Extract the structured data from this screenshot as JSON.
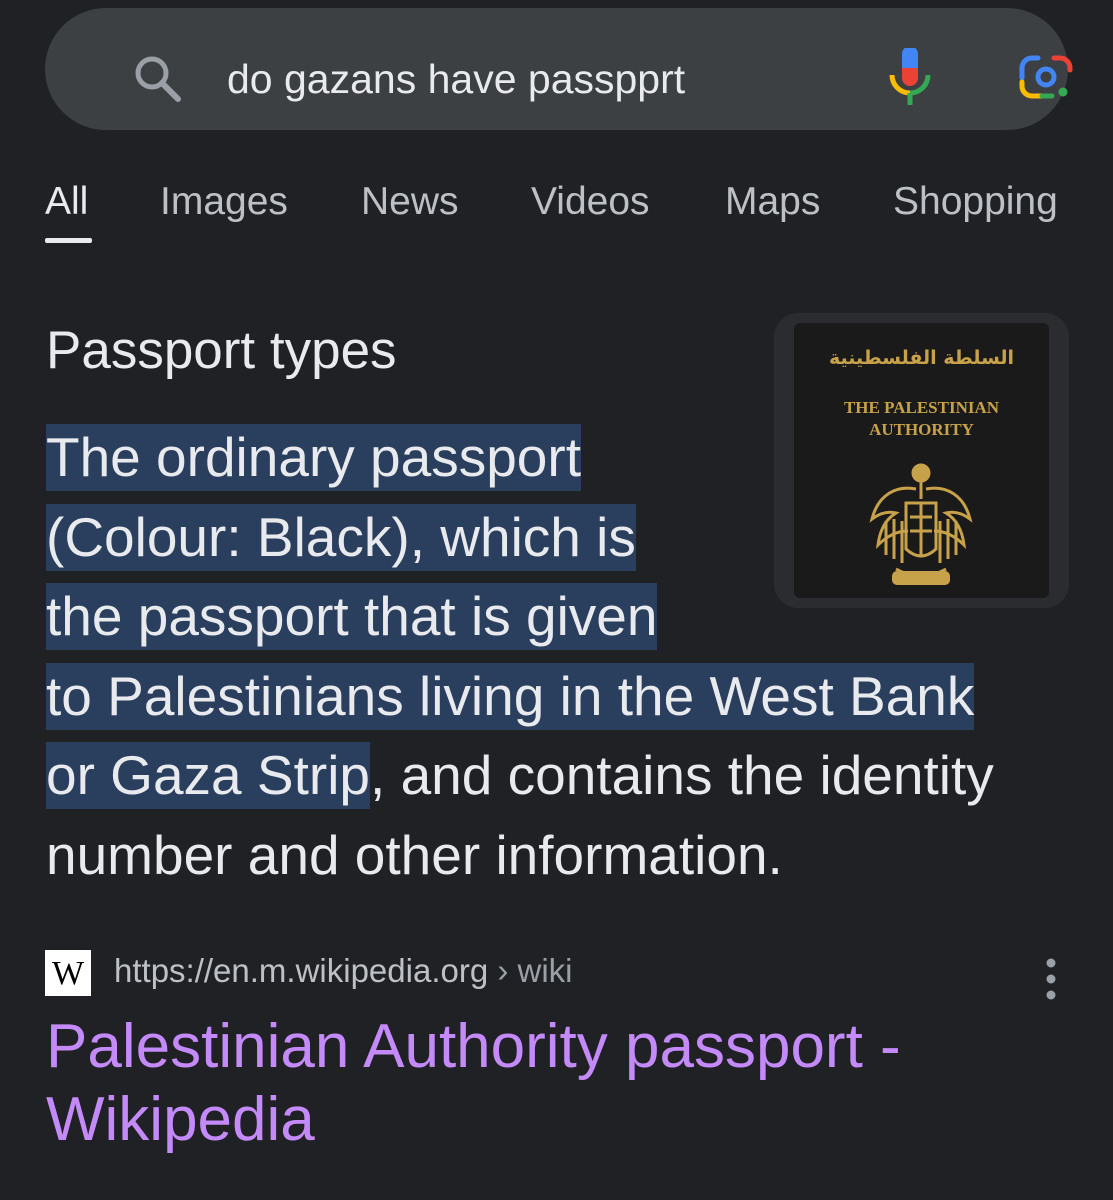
{
  "search": {
    "query": "do gazans have passpprt"
  },
  "tabs": [
    {
      "label": "All",
      "active": true
    },
    {
      "label": "Images"
    },
    {
      "label": "News"
    },
    {
      "label": "Videos"
    },
    {
      "label": "Maps"
    },
    {
      "label": "Shopping"
    }
  ],
  "snippet": {
    "heading": "Passport types",
    "highlighted_lines": [
      "The ordinary passport",
      "(Colour: Black), which is",
      "the passport that is given",
      "to Palestinians living in the West Bank",
      "or Gaza Strip"
    ],
    "rest_text": ", and contains the identity number and other information.",
    "image": {
      "arabic_text": "السلطة الفلسطينية",
      "english_line1": "THE PALESTINIAN",
      "english_line2": "AUTHORITY"
    }
  },
  "result": {
    "favicon_letter": "W",
    "url": "https://en.m.wikipedia.org",
    "breadcrumb": " › wiki",
    "title": "Palestinian Authority passport - Wikipedia"
  },
  "colors": {
    "background": "#202124",
    "search_bar": "#3c4043",
    "highlight": "#2a3e5e",
    "link_visited": "#c58af9"
  }
}
